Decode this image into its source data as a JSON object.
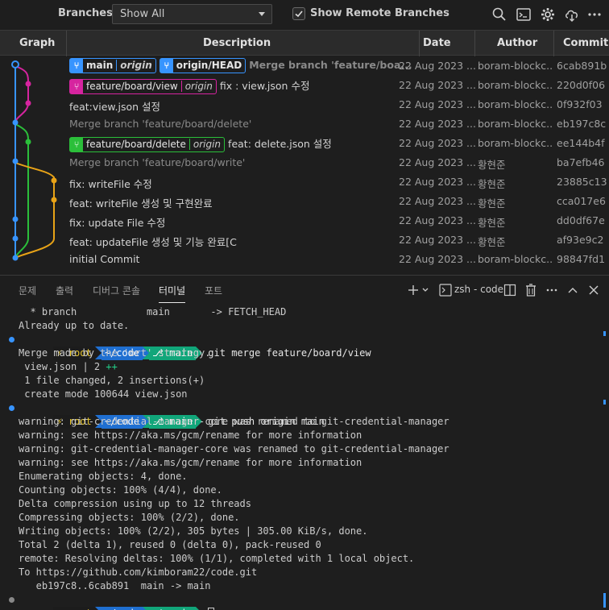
{
  "toolbar": {
    "branches_label": "Branches:",
    "branch_select_value": "Show All",
    "show_remote_label": "Show Remote Branches",
    "show_remote_checked": true
  },
  "columns": {
    "graph": "Graph",
    "description": "Description",
    "date": "Date",
    "author": "Author",
    "commit": "Commit"
  },
  "commits": [
    {
      "refs": [
        {
          "name": "main",
          "remote": "origin",
          "color": "blue",
          "current": true
        },
        {
          "name": "origin/HEAD",
          "remote": "",
          "color": "blue"
        }
      ],
      "message": "Merge branch 'feature/boa...",
      "date": "22 Aug 2023 ...",
      "author": "boram-blockc...",
      "hash": "6cab891b",
      "style": "bold"
    },
    {
      "refs": [
        {
          "name": "feature/board/view",
          "remote": "origin",
          "color": "pink"
        }
      ],
      "message": "fix : view.json 수정",
      "date": "22 Aug 2023 ...",
      "author": "boram-blockc...",
      "hash": "220d0f06",
      "style": "normal"
    },
    {
      "refs": [],
      "message": "feat:view.json 설정",
      "date": "22 Aug 2023 ...",
      "author": "boram-blockc...",
      "hash": "0f932f03",
      "style": "normal"
    },
    {
      "refs": [],
      "message": "Merge branch 'feature/board/delete'",
      "date": "22 Aug 2023 ...",
      "author": "boram-blockc...",
      "hash": "eb197c8c",
      "style": "dim"
    },
    {
      "refs": [
        {
          "name": "feature/board/delete",
          "remote": "origin",
          "color": "green"
        }
      ],
      "message": "feat: delete.json 설정",
      "date": "22 Aug 2023 ...",
      "author": "boram-blockc...",
      "hash": "ee144b4f",
      "style": "normal"
    },
    {
      "refs": [],
      "message": "Merge branch 'feature/board/write'",
      "date": "22 Aug 2023 ...",
      "author": "황현준",
      "hash": "ba7efb46",
      "style": "dim"
    },
    {
      "refs": [],
      "message": "fix: writeFile 수정",
      "date": "22 Aug 2023 ...",
      "author": "황현준",
      "hash": "23885c13",
      "style": "normal"
    },
    {
      "refs": [],
      "message": "feat: writeFile 생성 및 구현완료",
      "date": "22 Aug 2023 ...",
      "author": "황현준",
      "hash": "cca017e6",
      "style": "normal"
    },
    {
      "refs": [],
      "message": "fix: update File 수정",
      "date": "22 Aug 2023 ...",
      "author": "황현준",
      "hash": "dd0df67e",
      "style": "normal"
    },
    {
      "refs": [],
      "message": "feat: updateFile 생성 및 기능 완료[C",
      "date": "22 Aug 2023 ...",
      "author": "황현준",
      "hash": "af93e9c2",
      "style": "normal"
    },
    {
      "refs": [],
      "message": "initial Commit",
      "date": "22 Aug 2023 ...",
      "author": "boram-blockc...",
      "hash": "98847fd1",
      "style": "normal"
    }
  ],
  "panel": {
    "tabs": [
      "문제",
      "출력",
      "디버그 콘솔",
      "터미널",
      "포트"
    ],
    "active_tab": "터미널",
    "terminal_name": "zsh - code"
  },
  "terminal": {
    "prompt_user": "root",
    "prompt_dir": "~/code",
    "prompt_branch": "main",
    "lines_top": [
      "  * branch            main       -> FETCH_HEAD",
      "Already up to date."
    ],
    "cmd1": "git merge feature/board/view",
    "out1": [
      "Merge made by the 'ort' strategy.",
      " view.json | 2 ",
      " 1 file changed, 2 insertions(+)",
      " create mode 100644 view.json"
    ],
    "out1_plus": "++",
    "cmd2": "git push origin main",
    "out2": [
      "warning: git-credential-manager-core was renamed to git-credential-manager",
      "warning: see https://aka.ms/gcm/rename for more information",
      "warning: git-credential-manager-core was renamed to git-credential-manager",
      "warning: see https://aka.ms/gcm/rename for more information",
      "Enumerating objects: 4, done.",
      "Counting objects: 100% (4/4), done.",
      "Delta compression using up to 12 threads",
      "Compressing objects: 100% (2/2), done.",
      "Writing objects: 100% (2/2), 305 bytes | 305.00 KiB/s, done.",
      "Total 2 (delta 1), reused 0 (delta 0), pack-reused 0",
      "remote: Resolving deltas: 100% (1/1), completed with 1 local object.",
      "To https://github.com/kimboram22/code.git",
      "   eb197c8..6cab891  main -> main"
    ]
  }
}
